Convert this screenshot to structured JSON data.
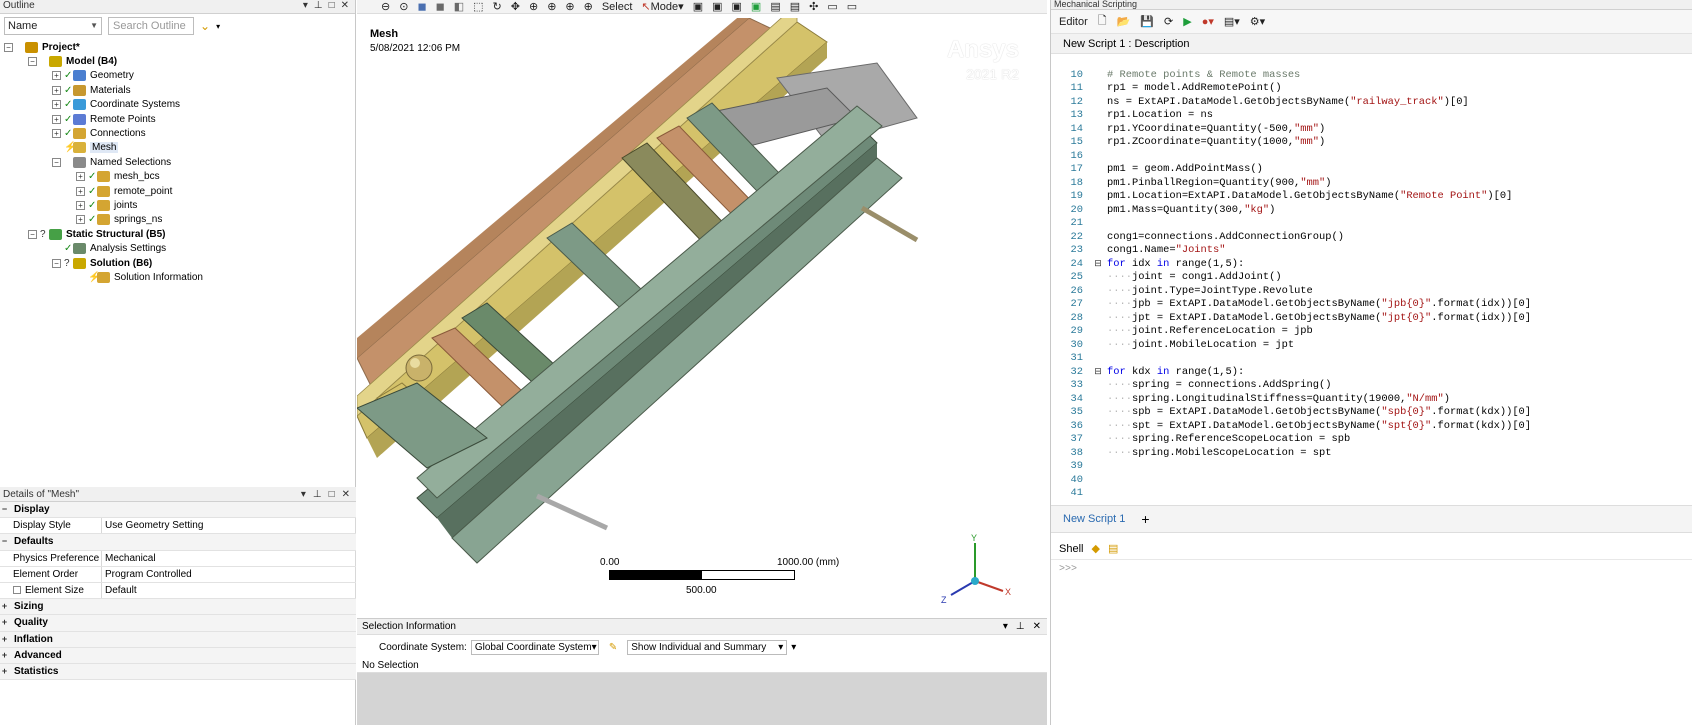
{
  "outline": {
    "title": "Outline",
    "name_select": "Name",
    "search_placeholder": "Search Outline",
    "tree": [
      {
        "label": "Project*",
        "depth": 0,
        "bold": true,
        "exp": "−",
        "check": "",
        "color": "#c99000"
      },
      {
        "label": "Model (B4)",
        "depth": 1,
        "bold": true,
        "exp": "−",
        "check": "",
        "color": "#c9a800"
      },
      {
        "label": "Geometry",
        "depth": 2,
        "bold": false,
        "exp": "+",
        "check": "✓",
        "color": "#4a7fd0"
      },
      {
        "label": "Materials",
        "depth": 2,
        "bold": false,
        "exp": "+",
        "check": "✓",
        "color": "#c79830"
      },
      {
        "label": "Coordinate Systems",
        "depth": 2,
        "bold": false,
        "exp": "+",
        "check": "✓",
        "color": "#3a9ad9"
      },
      {
        "label": "Remote Points",
        "depth": 2,
        "bold": false,
        "exp": "+",
        "check": "✓",
        "color": "#5c7bd4"
      },
      {
        "label": "Connections",
        "depth": 2,
        "bold": false,
        "exp": "+",
        "check": "✓",
        "color": "#d4a532"
      },
      {
        "label": "Mesh",
        "depth": 2,
        "bold": false,
        "exp": "",
        "check": "⚡",
        "color": "#d9b13a",
        "selected": true
      },
      {
        "label": "Named Selections",
        "depth": 2,
        "bold": false,
        "exp": "−",
        "check": "",
        "color": "#8a8a8a"
      },
      {
        "label": "mesh_bcs",
        "depth": 3,
        "bold": false,
        "exp": "+",
        "check": "✓",
        "color": "#d4a532"
      },
      {
        "label": "remote_point",
        "depth": 3,
        "bold": false,
        "exp": "+",
        "check": "✓",
        "color": "#d4a532"
      },
      {
        "label": "joints",
        "depth": 3,
        "bold": false,
        "exp": "+",
        "check": "✓",
        "color": "#d4a532"
      },
      {
        "label": "springs_ns",
        "depth": 3,
        "bold": false,
        "exp": "+",
        "check": "✓",
        "color": "#d4a532"
      },
      {
        "label": "Static Structural (B5)",
        "depth": 1,
        "bold": true,
        "exp": "−",
        "check": "?",
        "color": "#46a046"
      },
      {
        "label": "Analysis Settings",
        "depth": 2,
        "bold": false,
        "exp": "",
        "check": "✓",
        "color": "#6a8a6a"
      },
      {
        "label": "Solution (B6)",
        "depth": 2,
        "bold": true,
        "exp": "−",
        "check": "?",
        "color": "#c9a800"
      },
      {
        "label": "Solution Information",
        "depth": 3,
        "bold": false,
        "exp": "",
        "check": "⚡",
        "color": "#d4a532"
      }
    ]
  },
  "details": {
    "title": "Details of \"Mesh\"",
    "rows": [
      {
        "type": "group",
        "label": "Display",
        "sign": "−"
      },
      {
        "type": "row",
        "key": "Display Style",
        "value": "Use Geometry Setting"
      },
      {
        "type": "group",
        "label": "Defaults",
        "sign": "−"
      },
      {
        "type": "row",
        "key": "Physics Preference",
        "value": "Mechanical"
      },
      {
        "type": "row",
        "key": "Element Order",
        "value": "Program Controlled"
      },
      {
        "type": "row",
        "key": "Element Size",
        "value": "Default",
        "checkbox": true
      },
      {
        "type": "group",
        "label": "Sizing",
        "sign": "+"
      },
      {
        "type": "group",
        "label": "Quality",
        "sign": "+"
      },
      {
        "type": "group",
        "label": "Inflation",
        "sign": "+"
      },
      {
        "type": "group",
        "label": "Advanced",
        "sign": "+"
      },
      {
        "type": "group",
        "label": "Statistics",
        "sign": "+"
      }
    ]
  },
  "toolbar": {
    "select": "Select",
    "mode": "Mode"
  },
  "viewport": {
    "title": "Mesh",
    "timestamp": "5/08/2021 12:06 PM",
    "brand": "Ansys",
    "version": "2021 R2",
    "scale_start": "0.00",
    "scale_end": "1000.00 (mm)",
    "scale_mid": "500.00",
    "triad": {
      "x": "X",
      "y": "Y",
      "z": "Z"
    }
  },
  "selection_info": {
    "title": "Selection Information",
    "coord_label": "Coordinate System:",
    "coord_value": "Global Coordinate System",
    "show_value": "Show Individual and Summary",
    "status": "No Selection"
  },
  "scripting": {
    "title": "Mechanical Scripting",
    "editor_label": "Editor",
    "description": "New Script 1 : Description",
    "tab": "New Script 1",
    "add_tab": "+",
    "shell_label": "Shell",
    "prompt": ">>>",
    "lines": [
      {
        "n": "10",
        "html": "<span class='cm'># Remote points &amp; Remote masses</span>"
      },
      {
        "n": "11",
        "html": "rp1 = model.AddRemotePoint()"
      },
      {
        "n": "12",
        "html": "ns = ExtAPI.DataModel.GetObjectsByName(<span class='str'>\"railway_track\"</span>)[0]"
      },
      {
        "n": "13",
        "html": "rp1.Location = ns"
      },
      {
        "n": "14",
        "html": "rp1.YCoordinate=Quantity(-500,<span class='str'>\"mm\"</span>)"
      },
      {
        "n": "15",
        "html": "rp1.ZCoordinate=Quantity(1000,<span class='str'>\"mm\"</span>)"
      },
      {
        "n": "16",
        "html": ""
      },
      {
        "n": "17",
        "html": "pm1 = geom.AddPointMass()"
      },
      {
        "n": "18",
        "html": "pm1.PinballRegion=Quantity(900,<span class='str'>\"mm\"</span>)"
      },
      {
        "n": "19",
        "html": "pm1.Location=ExtAPI.DataModel.GetObjectsByName(<span class='str'>\"Remote Point\"</span>)[0]"
      },
      {
        "n": "20",
        "html": "pm1.Mass=Quantity(300,<span class='str'>\"kg\"</span>)"
      },
      {
        "n": "21",
        "html": ""
      },
      {
        "n": "22",
        "html": "cong1=connections.AddConnectionGroup()"
      },
      {
        "n": "23",
        "html": "cong1.Name=<span class='str'>\"Joints\"</span>"
      },
      {
        "n": "24",
        "html": "<span class='kw'>for</span> idx <span class='kw'>in</span> range(1,5):",
        "fold": "−"
      },
      {
        "n": "25",
        "html": "<span class='dots'>····</span>joint = cong1.AddJoint()"
      },
      {
        "n": "26",
        "html": "<span class='dots'>····</span>joint.Type=JointType.Revolute"
      },
      {
        "n": "27",
        "html": "<span class='dots'>····</span>jpb = ExtAPI.DataModel.GetObjectsByName(<span class='str'>\"jpb{0}\"</span>.format(idx))[0]"
      },
      {
        "n": "28",
        "html": "<span class='dots'>····</span>jpt = ExtAPI.DataModel.GetObjectsByName(<span class='str'>\"jpt{0}\"</span>.format(idx))[0]"
      },
      {
        "n": "29",
        "html": "<span class='dots'>····</span>joint.ReferenceLocation = jpb"
      },
      {
        "n": "30",
        "html": "<span class='dots'>····</span>joint.MobileLocation = jpt"
      },
      {
        "n": "31",
        "html": ""
      },
      {
        "n": "32",
        "html": "<span class='kw'>for</span> kdx <span class='kw'>in</span> range(1,5):",
        "fold": "−"
      },
      {
        "n": "33",
        "html": "<span class='dots'>····</span>spring = connections.AddSpring()"
      },
      {
        "n": "34",
        "html": "<span class='dots'>····</span>spring.LongitudinalStiffness=Quantity(19000,<span class='str'>\"N/mm\"</span>)"
      },
      {
        "n": "35",
        "html": "<span class='dots'>····</span>spb = ExtAPI.DataModel.GetObjectsByName(<span class='str'>\"spb{0}\"</span>.format(kdx))[0]"
      },
      {
        "n": "36",
        "html": "<span class='dots'>····</span>spt = ExtAPI.DataModel.GetObjectsByName(<span class='str'>\"spt{0}\"</span>.format(kdx))[0]"
      },
      {
        "n": "37",
        "html": "<span class='dots'>····</span>spring.ReferenceScopeLocation = spb"
      },
      {
        "n": "38",
        "html": "<span class='dots'>····</span>spring.MobileScopeLocation = spt"
      },
      {
        "n": "39",
        "html": ""
      },
      {
        "n": "40",
        "html": ""
      },
      {
        "n": "41",
        "html": ""
      }
    ]
  },
  "colors": {
    "accent": "#0078d4",
    "rail_yellow": "#d4c26a",
    "rail_green": "#7d9a86",
    "beam_orange": "#c4916a"
  }
}
